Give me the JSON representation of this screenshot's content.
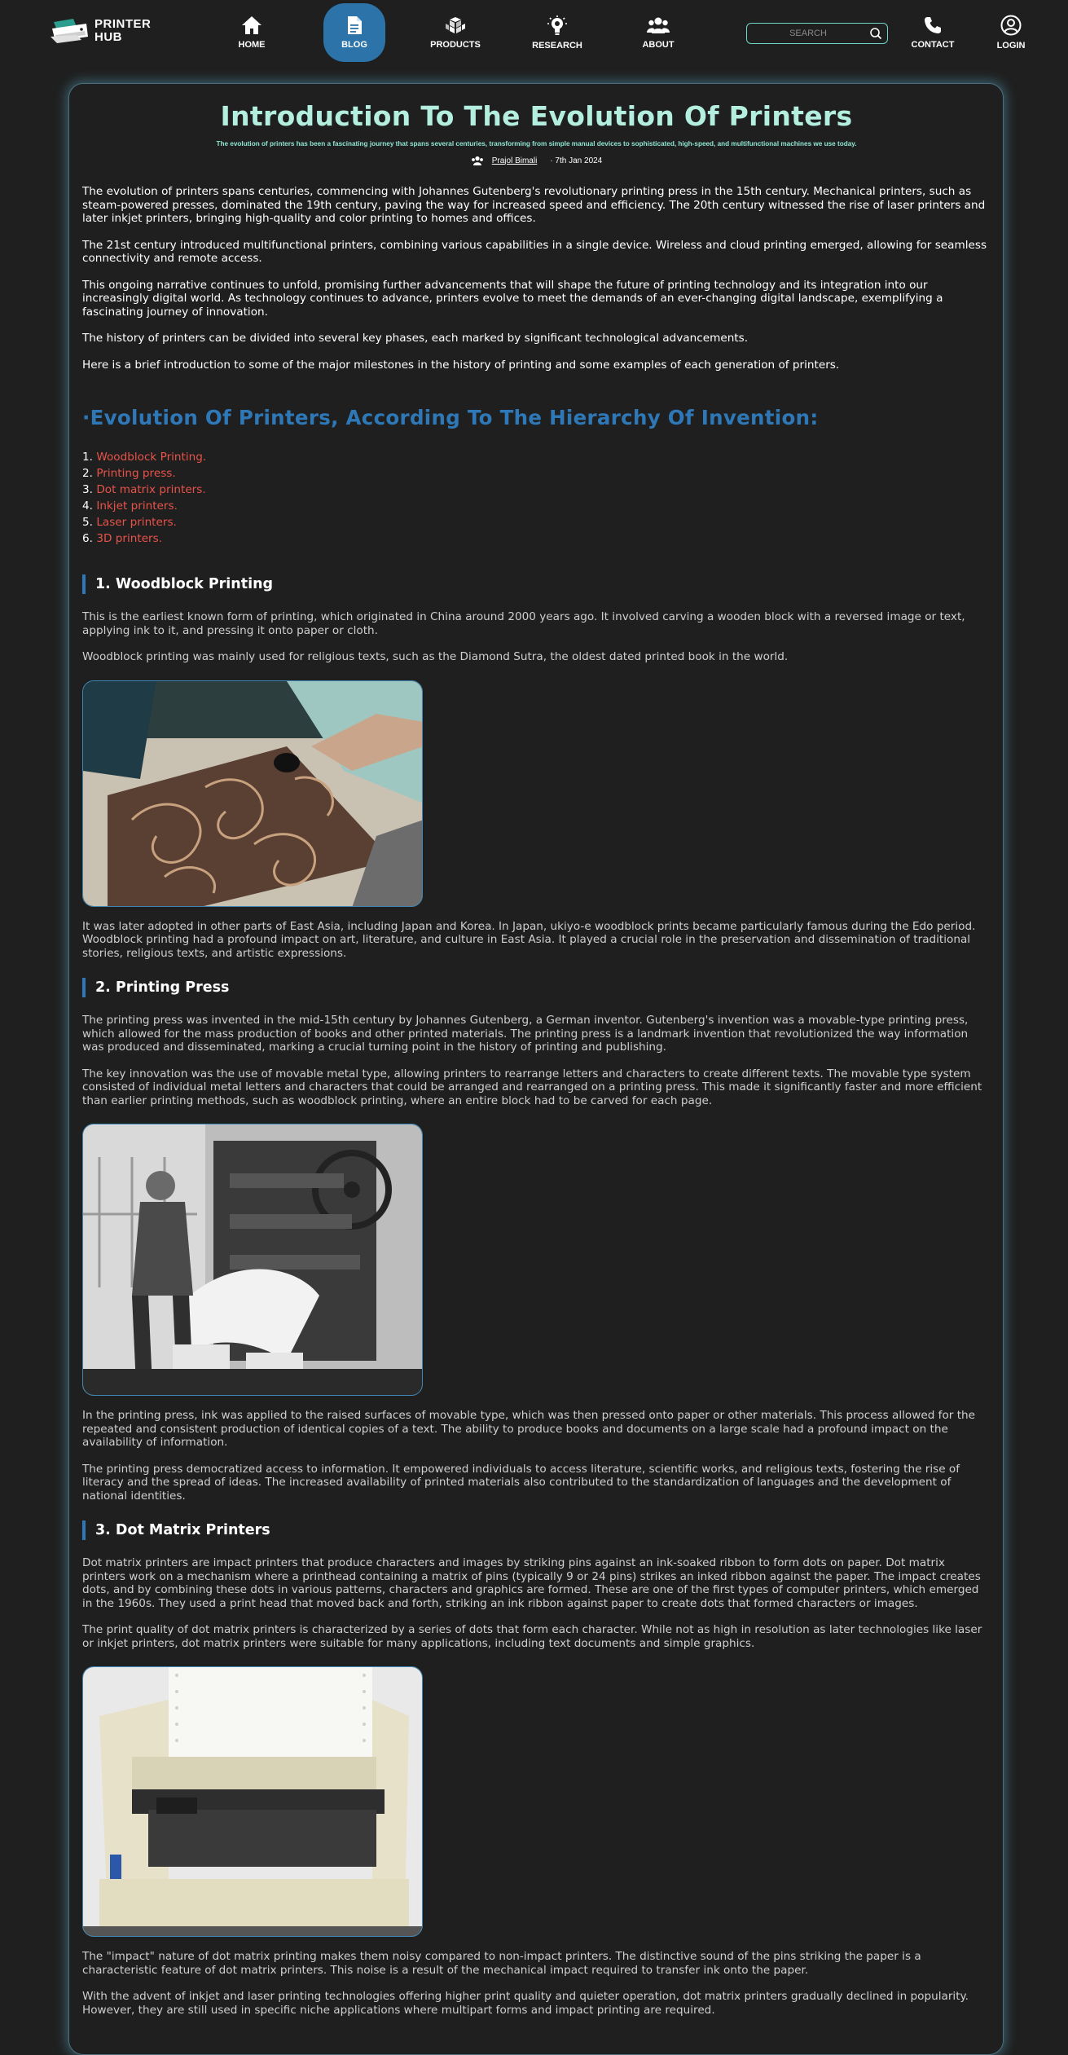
{
  "nav": {
    "brand_line1": "PRINTER",
    "brand_line2": "HUB",
    "items": [
      {
        "label": "HOME",
        "icon": "home-icon"
      },
      {
        "label": "BLOG",
        "icon": "document-icon"
      },
      {
        "label": "PRODUCTS",
        "icon": "cubes-icon"
      },
      {
        "label": "RESEARCH",
        "icon": "lightbulb-icon"
      },
      {
        "label": "ABOUT",
        "icon": "people-icon"
      },
      {
        "label": "CONTACT",
        "icon": "phone-icon"
      },
      {
        "label": "LOGIN",
        "icon": "user-circle-icon"
      }
    ],
    "search_placeholder": "SEARCH",
    "accent": "#2b73a8",
    "search_border": "#6fd5c7"
  },
  "article": {
    "title": "Introduction To The Evolution Of Printers",
    "subtitle": "The evolution of printers has been a fascinating journey that spans several centuries, transforming from simple manual devices to sophisticated, high-speed, and multifunctional machines we use today.",
    "author": "Prajol Bimali",
    "date": "· 7th Jan 2024",
    "intro": [
      "The evolution of printers spans centuries, commencing with Johannes Gutenberg's revolutionary printing press in the 15th century. Mechanical printers, such as steam-powered presses, dominated the 19th century, paving the way for increased speed and efficiency. The 20th century witnessed the rise of laser printers and later inkjet printers, bringing high-quality and color printing to homes and offices.",
      "The 21st century introduced multifunctional printers, combining various capabilities in a single device. Wireless and cloud printing emerged, allowing for seamless connectivity and remote access.",
      "This ongoing narrative continues to unfold, promising further advancements that will shape the future of printing technology and its integration into our increasingly digital world. As technology continues to advance, printers evolve to meet the demands of an ever-changing digital landscape, exemplifying a fascinating journey of innovation.",
      "The history of printers can be divided into several key phases, each marked by significant technological advancements.",
      "Here is a brief introduction to some of the major milestones in the history of printing and some examples of each generation of printers."
    ],
    "hierarchy_heading": "·Evolution Of Printers, According To The Hierarchy Of Invention:",
    "toc": [
      {
        "num": "1.",
        "label": "Woodblock Printing."
      },
      {
        "num": "2.",
        "label": "Printing press."
      },
      {
        "num": "3.",
        "label": "Dot matrix printers."
      },
      {
        "num": "4.",
        "label": "Inkjet printers."
      },
      {
        "num": "5.",
        "label": "Laser printers."
      },
      {
        "num": "6.",
        "label": "3D printers."
      }
    ],
    "sections": [
      {
        "heading": "1. Woodblock Printing",
        "before": [
          "This is the earliest known form of printing, which originated in China around 2000 years ago. It involved carving a wooden block with a reversed image or text, applying ink to it, and pressing it onto paper or cloth.",
          "Woodblock printing was mainly used for religious texts, such as the Diamond Sutra, the oldest dated printed book in the world."
        ],
        "after": [
          "It was later adopted in other parts of East Asia, including Japan and Korea. In Japan, ukiyo-e woodblock prints became particularly famous during the Edo period. Woodblock printing had a profound impact on art, literature, and culture in East Asia. It played a crucial role in the preservation and dissemination of traditional stories, religious texts, and artistic expressions."
        ]
      },
      {
        "heading": "2. Printing Press",
        "before": [
          "The printing press was invented in the mid-15th century by Johannes Gutenberg, a German inventor. Gutenberg's invention was a movable-type printing press, which allowed for the mass production of books and other printed materials. The printing press is a landmark invention that revolutionized the way information was produced and disseminated, marking a crucial turning point in the history of printing and publishing.",
          "The key innovation was the use of movable metal type, allowing printers to rearrange letters and characters to create different texts. The movable type system consisted of individual metal letters and characters that could be arranged and rearranged on a printing press. This made it significantly faster and more efficient than earlier printing methods, such as woodblock printing, where an entire block had to be carved for each page."
        ],
        "after": [
          "In the printing press, ink was applied to the raised surfaces of movable type, which was then pressed onto paper or other materials. This process allowed for the repeated and consistent production of identical copies of a text. The ability to produce books and documents on a large scale had a profound impact on the availability of information.",
          "The printing press democratized access to information. It empowered individuals to access literature, scientific works, and religious texts, fostering the rise of literacy and the spread of ideas. The increased availability of printed materials also contributed to the standardization of languages and the development of national identities."
        ]
      },
      {
        "heading": "3. Dot Matrix Printers",
        "before": [
          "Dot matrix printers are impact printers that produce characters and images by striking pins against an ink-soaked ribbon to form dots on paper. Dot matrix printers work on a mechanism where a printhead containing a matrix of pins (typically 9 or 24 pins) strikes an inked ribbon against the paper. The impact creates dots, and by combining these dots in various patterns, characters and graphics are formed. These are one of the first types of computer printers, which emerged in the 1960s. They used a print head that moved back and forth, striking an ink ribbon against paper to create dots that formed characters or images.",
          "The print quality of dot matrix printers is characterized by a series of dots that form each character. While not as high in resolution as later technologies like laser or inkjet printers, dot matrix printers were suitable for many applications, including text documents and simple graphics."
        ],
        "after": [
          "The \"impact\" nature of dot matrix printing makes them noisy compared to non-impact printers. The distinctive sound of the pins striking the paper is a characteristic feature of dot matrix printers. This noise is a result of the mechanical impact required to transfer ink onto the paper.",
          "With the advent of inkjet and laser printing technologies offering higher print quality and quieter operation, dot matrix printers gradually declined in popularity. However, they are still used in specific niche applications where multipart forms and impact printing are required."
        ]
      }
    ]
  },
  "colors": {
    "title": "#b3eede",
    "heading_blue": "#2e78b8",
    "toc_link": "#e8534a",
    "card_glow": "#5aaac8"
  }
}
